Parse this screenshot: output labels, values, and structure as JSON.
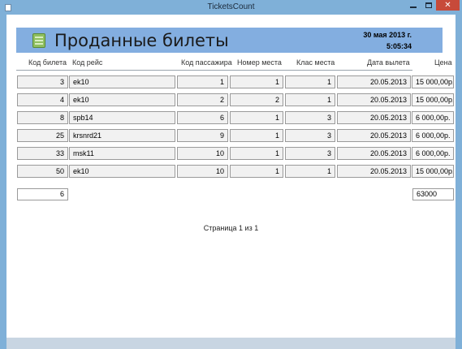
{
  "window": {
    "title": "TicketsCount"
  },
  "report": {
    "title": "Проданные билеты",
    "date": "30 мая 2013 г.",
    "time": "5:05:34",
    "columns": [
      "Код билета",
      "Код рейс",
      "Код пассажира",
      "Номер места",
      "Клас места",
      "Дата вылета",
      "Цена"
    ],
    "rows": [
      {
        "ticket_id": "3",
        "flight": "ek10",
        "passenger_id": "1",
        "seat": "1",
        "class": "1",
        "date": "20.05.2013",
        "price": "15 000,00р."
      },
      {
        "ticket_id": "4",
        "flight": "ek10",
        "passenger_id": "2",
        "seat": "2",
        "class": "1",
        "date": "20.05.2013",
        "price": "15 000,00р."
      },
      {
        "ticket_id": "8",
        "flight": "spb14",
        "passenger_id": "6",
        "seat": "1",
        "class": "3",
        "date": "20.05.2013",
        "price": "6 000,00р."
      },
      {
        "ticket_id": "25",
        "flight": "krsnrd21",
        "passenger_id": "9",
        "seat": "1",
        "class": "3",
        "date": "20.05.2013",
        "price": "6 000,00р."
      },
      {
        "ticket_id": "33",
        "flight": "msk11",
        "passenger_id": "10",
        "seat": "1",
        "class": "3",
        "date": "20.05.2013",
        "price": "6 000,00р."
      },
      {
        "ticket_id": "50",
        "flight": "ek10",
        "passenger_id": "10",
        "seat": "1",
        "class": "1",
        "date": "20.05.2013",
        "price": "15 000,00р."
      }
    ],
    "count_total": "6",
    "price_total": "63000",
    "page_label": "Страница 1 из 1"
  }
}
